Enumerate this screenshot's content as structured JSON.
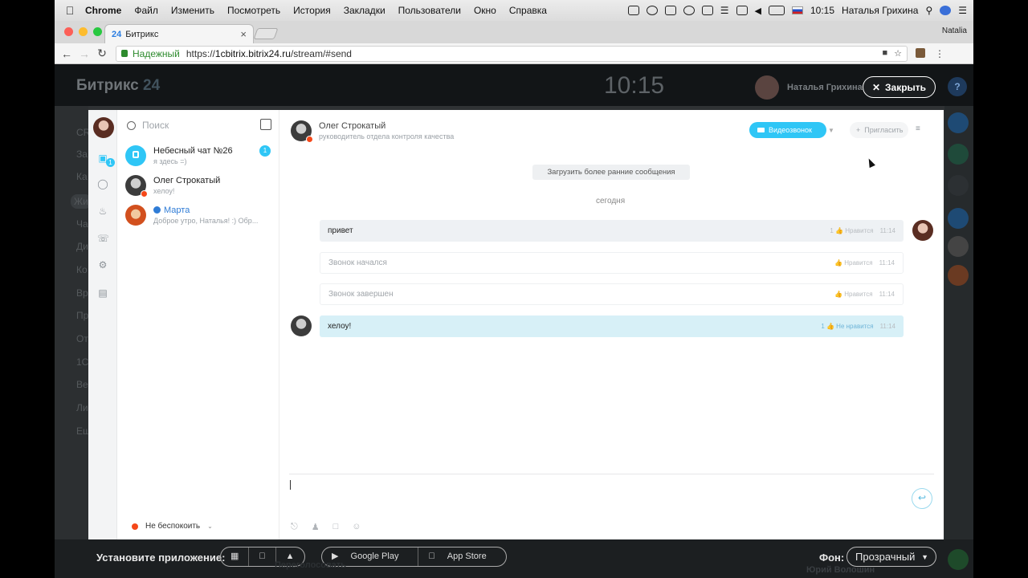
{
  "menubar": {
    "items": [
      "Chrome",
      "Файл",
      "Изменить",
      "Посмотреть",
      "История",
      "Закладки",
      "Пользователи",
      "Окно",
      "Справка"
    ],
    "clock": "10:15",
    "user": "Наталья Грихина"
  },
  "browser": {
    "tab_title": "Битрикс",
    "tab_favicon": "24",
    "profile": "Natalia",
    "secure_label": "Надежный",
    "url_prefix": "https://",
    "url_host": "1cbitrix.bitrix24.ru",
    "url_path": "/stream/#send"
  },
  "portal": {
    "logo": "Битрикс",
    "logo_num": "24",
    "clock": "10:15",
    "user_name": "Наталья Грихина",
    "close_label": "Закрыть",
    "help": "?",
    "install_label": "Установите приложение:",
    "google_play": "Google Play",
    "app_store": "App Store",
    "fon_label": "Фон:",
    "fon_value": "Прозрачный",
    "behind_left_items": [
      "CR",
      "За",
      "Ка",
      "Жи",
      "Ча",
      "Ди",
      "Ко",
      "Вр",
      "Пр",
      "От",
      "1С",
      "Ве",
      "Ли",
      "Ещ"
    ],
    "behind_bottom": "Переголосовать",
    "behind_right_name": "Юрий Волошин"
  },
  "messenger": {
    "search_placeholder": "Поиск",
    "rail_badge": "1",
    "chats": [
      {
        "name": "Небесный чат №26",
        "last": "я здесь =)",
        "badge": "1"
      },
      {
        "name": "Олег Строкатый",
        "last": "хелоу!"
      },
      {
        "name": "Марта",
        "last": "Доброе утро, Наталья! :) Обр..."
      }
    ],
    "status": "Не беспокоить",
    "header": {
      "name": "Олег Строкатый",
      "position": "руководитель отдела контроля качества",
      "video_call": "Видеозвонок",
      "invite": "Пригласить"
    },
    "load_earlier": "Загрузить более ранние сообщения",
    "date_divider": "сегодня",
    "messages": [
      {
        "text": "привет",
        "likes": "1",
        "like_label": "Нравится",
        "time": "11:14"
      },
      {
        "text": "Звонок начался",
        "like_label": "Нравится",
        "time": "11:14"
      },
      {
        "text": "Звонок завершен",
        "like_label": "Нравится",
        "time": "11:14"
      },
      {
        "text": "хелоу!",
        "likes": "1",
        "like_label": "Не нравится",
        "time": "11:14"
      }
    ]
  },
  "colors": {
    "accent": "#2fc6f6",
    "dnd": "#f54819",
    "incoming_bg": "#d7f0f7"
  }
}
